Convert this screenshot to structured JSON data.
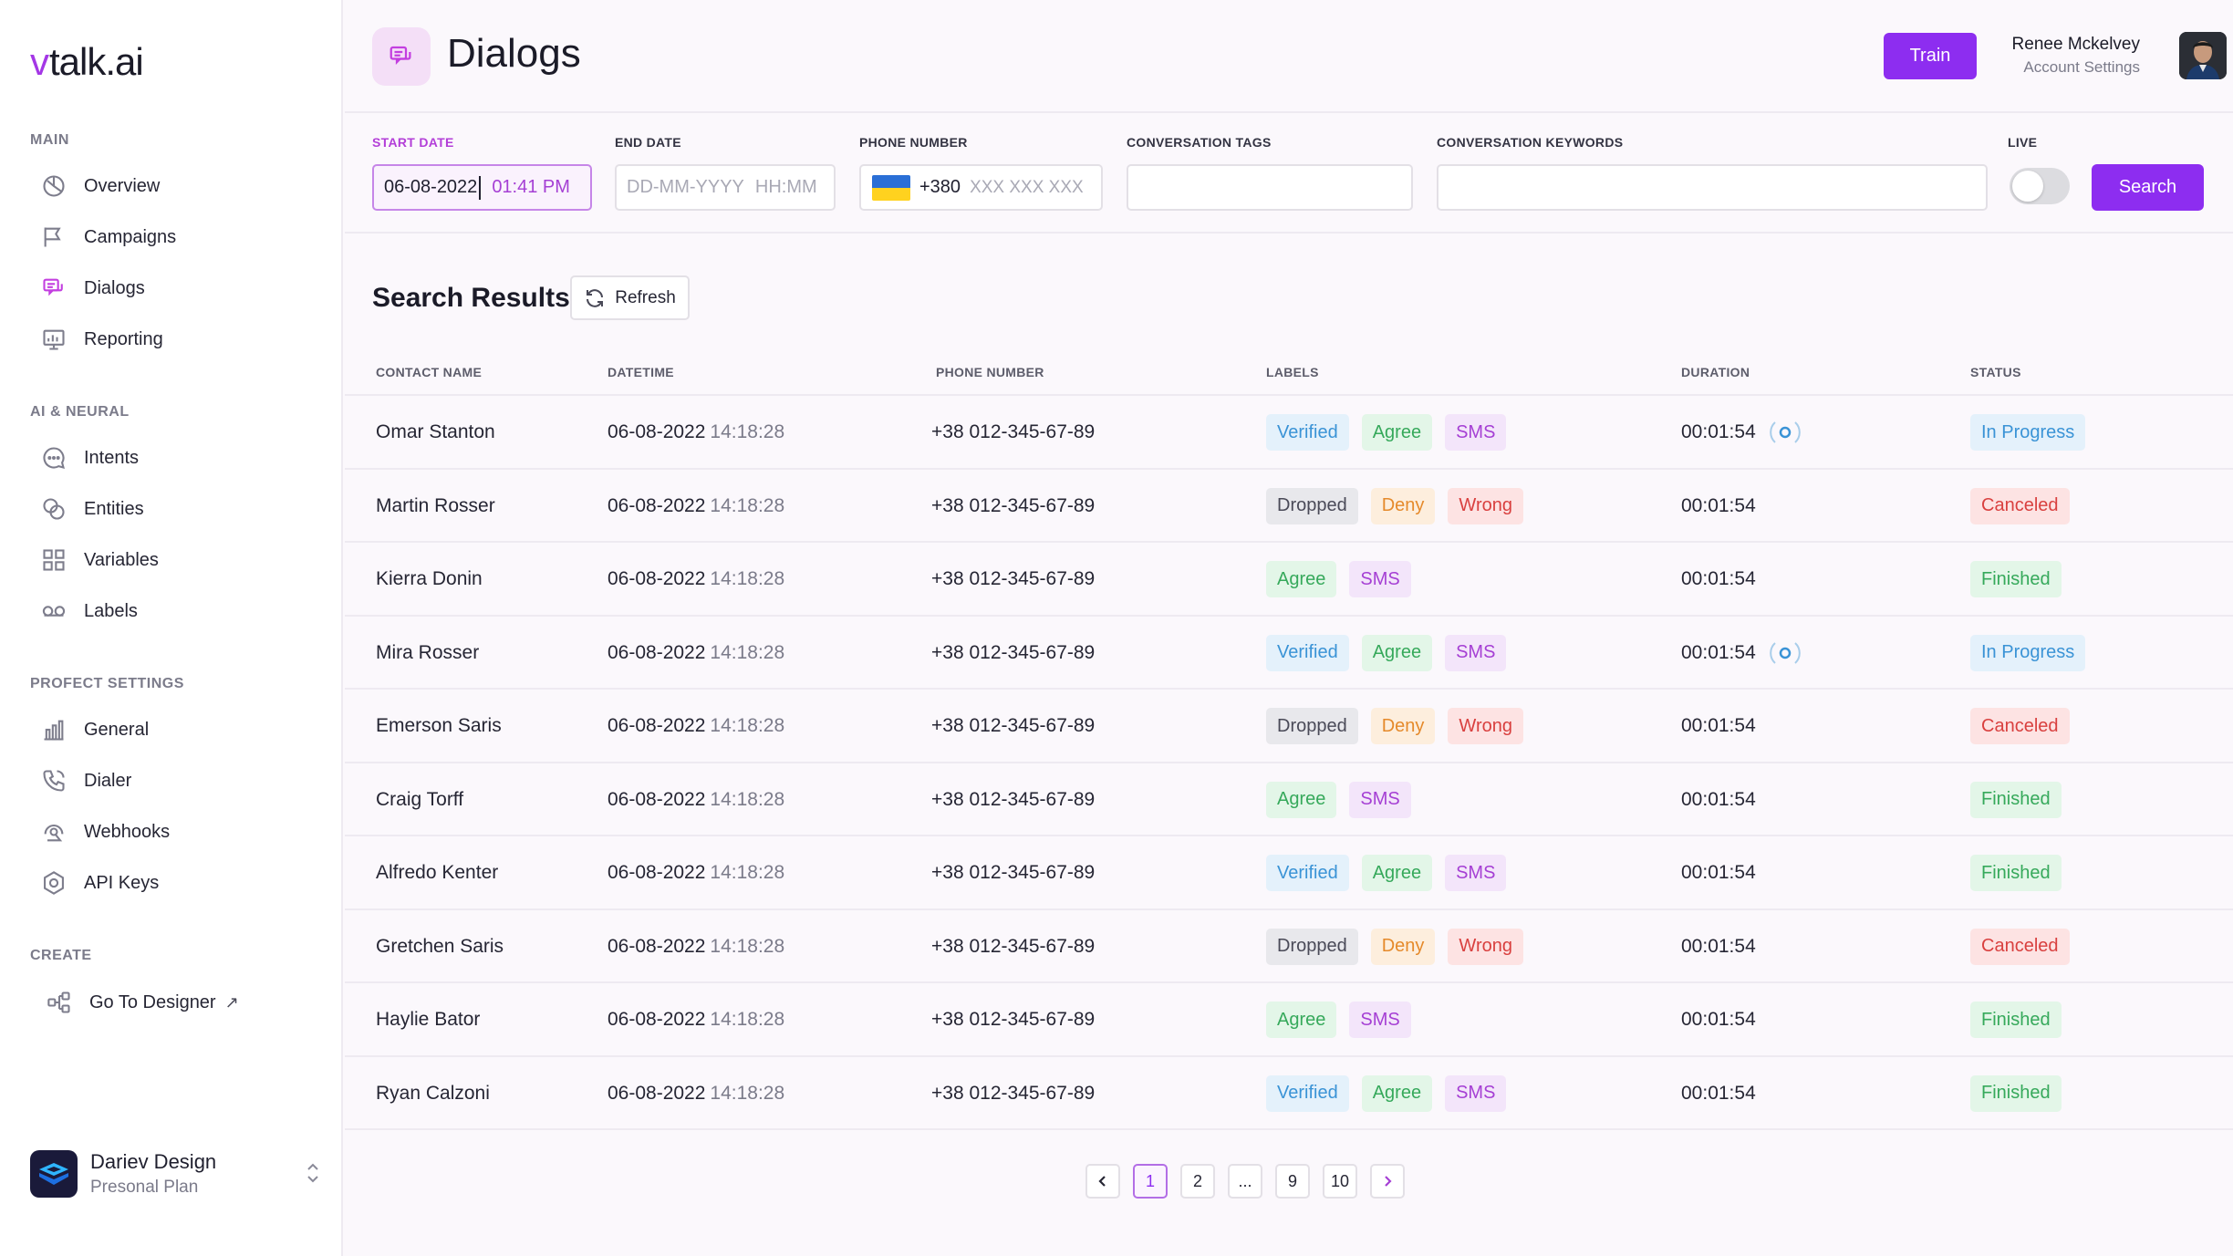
{
  "brand": {
    "logo_mark": "v",
    "logo_text": "talk.ai"
  },
  "sidebar": {
    "sections": [
      {
        "title": "MAIN",
        "items": [
          {
            "label": "Overview",
            "icon": "overview-icon"
          },
          {
            "label": "Campaigns",
            "icon": "campaigns-icon"
          },
          {
            "label": "Dialogs",
            "icon": "dialogs-icon",
            "active": true
          },
          {
            "label": "Reporting",
            "icon": "reporting-icon"
          }
        ]
      },
      {
        "title": "AI & NEURAL",
        "items": [
          {
            "label": "Intents",
            "icon": "intents-icon"
          },
          {
            "label": "Entities",
            "icon": "entities-icon"
          },
          {
            "label": "Variables",
            "icon": "variables-icon"
          },
          {
            "label": "Labels",
            "icon": "labels-icon"
          }
        ]
      },
      {
        "title": "PROFECT SETTINGS",
        "items": [
          {
            "label": "General",
            "icon": "general-icon"
          },
          {
            "label": "Dialer",
            "icon": "dialer-icon"
          },
          {
            "label": "Webhooks",
            "icon": "webhooks-icon"
          },
          {
            "label": "API Keys",
            "icon": "api-keys-icon"
          }
        ]
      },
      {
        "title": "CREATE",
        "items": [
          {
            "label": "Go To Designer",
            "icon": "designer-icon",
            "external": true
          }
        ]
      }
    ],
    "workspace": {
      "name": "Dariev Design",
      "plan": "Presonal Plan"
    }
  },
  "header": {
    "title": "Dialogs",
    "train_label": "Train",
    "user_name": "Renee Mckelvey",
    "user_sub": "Account Settings"
  },
  "filters": {
    "start_date": {
      "label": "START DATE",
      "date": "06-08-2022",
      "time": "01:41 PM"
    },
    "end_date": {
      "label": "END DATE",
      "date_placeholder": "DD-MM-YYYY",
      "time_placeholder": "HH:MM"
    },
    "phone": {
      "label": "PHONE NUMBER",
      "code": "+380",
      "placeholder": "XXX XXX XXX"
    },
    "tags": {
      "label": "CONVERSATION TAGS",
      "value": ""
    },
    "keywords": {
      "label": "CONVERSATION KEYWORDS",
      "value": ""
    },
    "live": {
      "label": "LIVE",
      "on": false
    },
    "search_label": "Search"
  },
  "results": {
    "title": "Search Results",
    "refresh_label": "Refresh",
    "columns": [
      "CONTACT NAME",
      "DATETIME",
      "PHONE NUMBER",
      "LABELS",
      "DURATION",
      "STATUS"
    ],
    "rows": [
      {
        "name": "Omar Stanton",
        "date": "06-08-2022",
        "time": "14:18:28",
        "phone": "+38 012-345-67-89",
        "labels": [
          "Verified",
          "Agree",
          "SMS"
        ],
        "duration": "00:01:54",
        "live": true,
        "status": "In Progress"
      },
      {
        "name": "Martin Rosser",
        "date": "06-08-2022",
        "time": "14:18:28",
        "phone": "+38 012-345-67-89",
        "labels": [
          "Dropped",
          "Deny",
          "Wrong"
        ],
        "duration": "00:01:54",
        "live": false,
        "status": "Canceled"
      },
      {
        "name": "Kierra Donin",
        "date": "06-08-2022",
        "time": "14:18:28",
        "phone": "+38 012-345-67-89",
        "labels": [
          "Agree",
          "SMS"
        ],
        "duration": "00:01:54",
        "live": false,
        "status": "Finished"
      },
      {
        "name": "Mira Rosser",
        "date": "06-08-2022",
        "time": "14:18:28",
        "phone": "+38 012-345-67-89",
        "labels": [
          "Verified",
          "Agree",
          "SMS"
        ],
        "duration": "00:01:54",
        "live": true,
        "status": "In Progress"
      },
      {
        "name": "Emerson Saris",
        "date": "06-08-2022",
        "time": "14:18:28",
        "phone": "+38 012-345-67-89",
        "labels": [
          "Dropped",
          "Deny",
          "Wrong"
        ],
        "duration": "00:01:54",
        "live": false,
        "status": "Canceled"
      },
      {
        "name": "Craig Torff",
        "date": "06-08-2022",
        "time": "14:18:28",
        "phone": "+38 012-345-67-89",
        "labels": [
          "Agree",
          "SMS"
        ],
        "duration": "00:01:54",
        "live": false,
        "status": "Finished"
      },
      {
        "name": "Alfredo Kenter",
        "date": "06-08-2022",
        "time": "14:18:28",
        "phone": "+38 012-345-67-89",
        "labels": [
          "Verified",
          "Agree",
          "SMS"
        ],
        "duration": "00:01:54",
        "live": false,
        "status": "Finished"
      },
      {
        "name": "Gretchen Saris",
        "date": "06-08-2022",
        "time": "14:18:28",
        "phone": "+38 012-345-67-89",
        "labels": [
          "Dropped",
          "Deny",
          "Wrong"
        ],
        "duration": "00:01:54",
        "live": false,
        "status": "Canceled"
      },
      {
        "name": "Haylie Bator",
        "date": "06-08-2022",
        "time": "14:18:28",
        "phone": "+38 012-345-67-89",
        "labels": [
          "Agree",
          "SMS"
        ],
        "duration": "00:01:54",
        "live": false,
        "status": "Finished"
      },
      {
        "name": "Ryan Calzoni",
        "date": "06-08-2022",
        "time": "14:18:28",
        "phone": "+38 012-345-67-89",
        "labels": [
          "Verified",
          "Agree",
          "SMS"
        ],
        "duration": "00:01:54",
        "live": false,
        "status": "Finished"
      }
    ]
  },
  "pagination": {
    "pages": [
      "1",
      "2",
      "...",
      "9",
      "10"
    ],
    "current": "1"
  },
  "colors": {
    "accent": "#8d2df0",
    "active_nav": "#c33fe0",
    "in_progress": "#3a93d6",
    "canceled": "#d9403f",
    "finished": "#36a95b"
  }
}
